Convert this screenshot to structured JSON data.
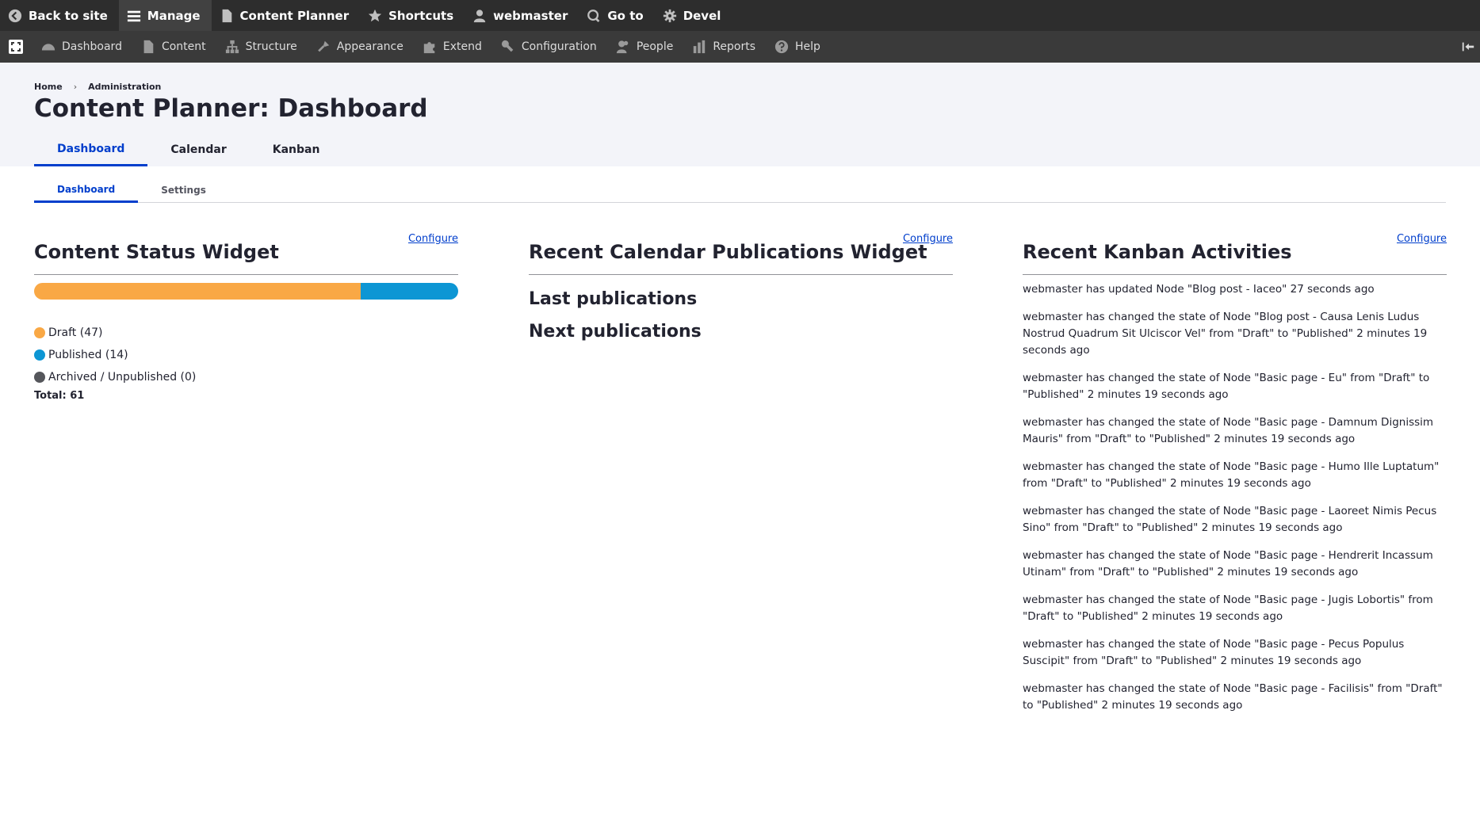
{
  "toolbar": {
    "back_to_site": "Back to site",
    "manage": "Manage",
    "content_planner": "Content Planner",
    "shortcuts": "Shortcuts",
    "user": "webmaster",
    "go_to": "Go to",
    "devel": "Devel"
  },
  "tray": {
    "items": [
      "Dashboard",
      "Content",
      "Structure",
      "Appearance",
      "Extend",
      "Configuration",
      "People",
      "Reports",
      "Help"
    ]
  },
  "breadcrumb": [
    "Home",
    "Administration"
  ],
  "page_title": "Content Planner: Dashboard",
  "primary_tabs": [
    "Dashboard",
    "Calendar",
    "Kanban"
  ],
  "secondary_tabs": [
    "Dashboard",
    "Settings"
  ],
  "configure_label": "Configure",
  "content_status": {
    "title": "Content Status Widget",
    "draft": {
      "label": "Draft (47)",
      "count": 47,
      "color": "#f9a845"
    },
    "published": {
      "label": "Published (14)",
      "count": 14,
      "color": "#0d96d4"
    },
    "archived": {
      "label": "Archived / Unpublished (0)",
      "count": 0,
      "color": "#55565b"
    },
    "total": "Total: 61"
  },
  "calendar_widget": {
    "title": "Recent Calendar Publications Widget",
    "last": "Last publications",
    "next": "Next publications"
  },
  "kanban_widget": {
    "title": "Recent Kanban Activities",
    "activities": [
      "webmaster has updated Node \"Blog post - Iaceo\" 27 seconds ago",
      "webmaster has changed the state of Node \"Blog post - Causa Lenis Ludus Nostrud Quadrum Sit Ulciscor Vel\" from \"Draft\" to \"Published\" 2 minutes 19 seconds ago",
      "webmaster has changed the state of Node \"Basic page - Eu\" from \"Draft\" to \"Published\" 2 minutes 19 seconds ago",
      "webmaster has changed the state of Node \"Basic page - Damnum Dignissim Mauris\" from \"Draft\" to \"Published\" 2 minutes 19 seconds ago",
      "webmaster has changed the state of Node \"Basic page - Humo Ille Luptatum\" from \"Draft\" to \"Published\" 2 minutes 19 seconds ago",
      "webmaster has changed the state of Node \"Basic page - Laoreet Nimis Pecus Sino\" from \"Draft\" to \"Published\" 2 minutes 19 seconds ago",
      "webmaster has changed the state of Node \"Basic page - Hendrerit Incassum Utinam\" from \"Draft\" to \"Published\" 2 minutes 19 seconds ago",
      "webmaster has changed the state of Node \"Basic page - Jugis Lobortis\" from \"Draft\" to \"Published\" 2 minutes 19 seconds ago",
      "webmaster has changed the state of Node \"Basic page - Pecus Populus Suscipit\" from \"Draft\" to \"Published\" 2 minutes 19 seconds ago",
      "webmaster has changed the state of Node \"Basic page - Facilisis\" from \"Draft\" to \"Published\" 2 minutes 19 seconds ago"
    ]
  }
}
